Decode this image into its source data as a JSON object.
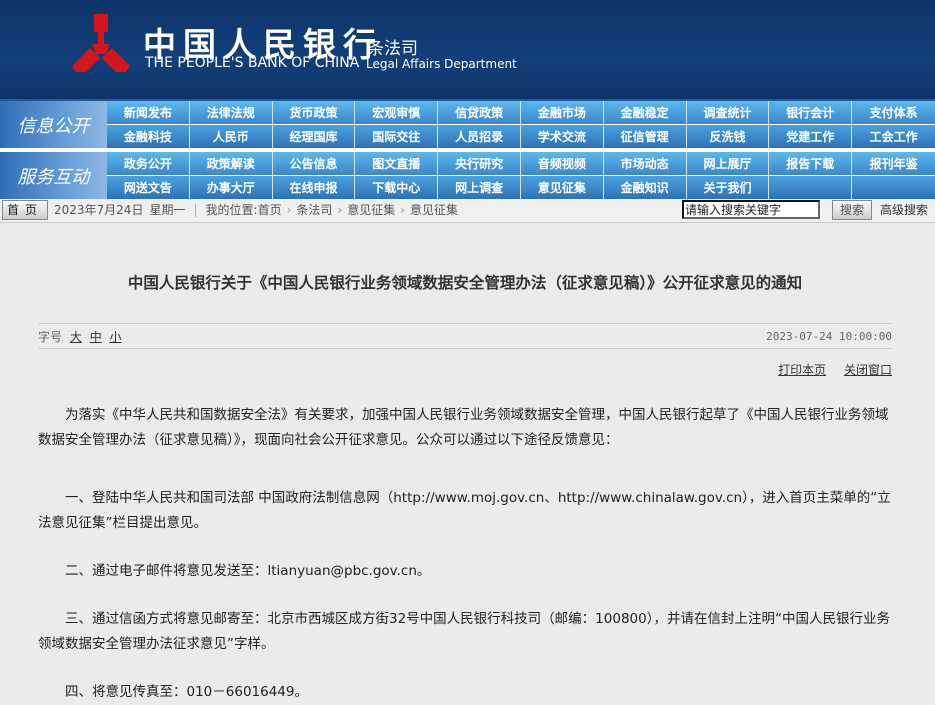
{
  "header": {
    "bank_cn": "中国人民银行",
    "bank_en": "THE PEOPLE'S BANK OF CHINA",
    "dept_cn": "条法司",
    "dept_en": "Legal Affairs Department"
  },
  "nav": {
    "groups": [
      {
        "label": "信息公开",
        "rows": [
          [
            "新闻发布",
            "法律法规",
            "货币政策",
            "宏观审慎",
            "信贷政策",
            "金融市场",
            "金融稳定",
            "调查统计",
            "银行会计",
            "支付体系"
          ],
          [
            "金融科技",
            "人民币",
            "经理国库",
            "国际交往",
            "人员招录",
            "学术交流",
            "征信管理",
            "反洗钱",
            "党建工作",
            "工会工作"
          ]
        ]
      },
      {
        "label": "服务互动",
        "rows": [
          [
            "政务公开",
            "政策解读",
            "公告信息",
            "图文直播",
            "央行研究",
            "音频视频",
            "市场动态",
            "网上展厅",
            "报告下载",
            "报刊年鉴"
          ],
          [
            "网送文告",
            "办事大厅",
            "在线申报",
            "下载中心",
            "网上调查",
            "意见征集",
            "金融知识",
            "关于我们",
            "",
            ""
          ]
        ]
      }
    ]
  },
  "crumb": {
    "home": "首页",
    "date": "2023年7月24日",
    "week": "星期一",
    "location_label": "我的位置:",
    "path": [
      "首页",
      "条法司",
      "意见征集",
      "意见征集"
    ],
    "search_placeholder": "请输入搜索关键字",
    "search_btn": "搜索",
    "advanced": "高级搜索"
  },
  "article": {
    "title": "中国人民银行关于《中国人民银行业务领域数据安全管理办法（征求意见稿）》公开征求意见的通知",
    "font_label": "字号",
    "font_sizes": [
      "大",
      "中",
      "小"
    ],
    "time": "2023-07-24 10:00:00",
    "print": "打印本页",
    "close": "关闭窗口",
    "paragraphs": [
      "为落实《中华人民共和国数据安全法》有关要求，加强中国人民银行业务领域数据安全管理，中国人民银行起草了《中国人民银行业务领域数据安全管理办法（征求意见稿）》，现面向社会公开征求意见。公众可以通过以下途径反馈意见：",
      "一、登陆中华人民共和国司法部 中国政府法制信息网（http://www.moj.gov.cn、http://www.chinalaw.gov.cn），进入首页主菜单的“立法意见征集”栏目提出意见。",
      "二、通过电子邮件将意见发送至：ltianyuan@pbc.gov.cn。",
      "三、通过信函方式将意见邮寄至：北京市西城区成方街32号中国人民银行科技司（邮编：100800），并请在信封上注明“中国人民银行业务领域数据安全管理办法征求意见”字样。",
      "四、将意见传真至：010－66016449。"
    ]
  }
}
